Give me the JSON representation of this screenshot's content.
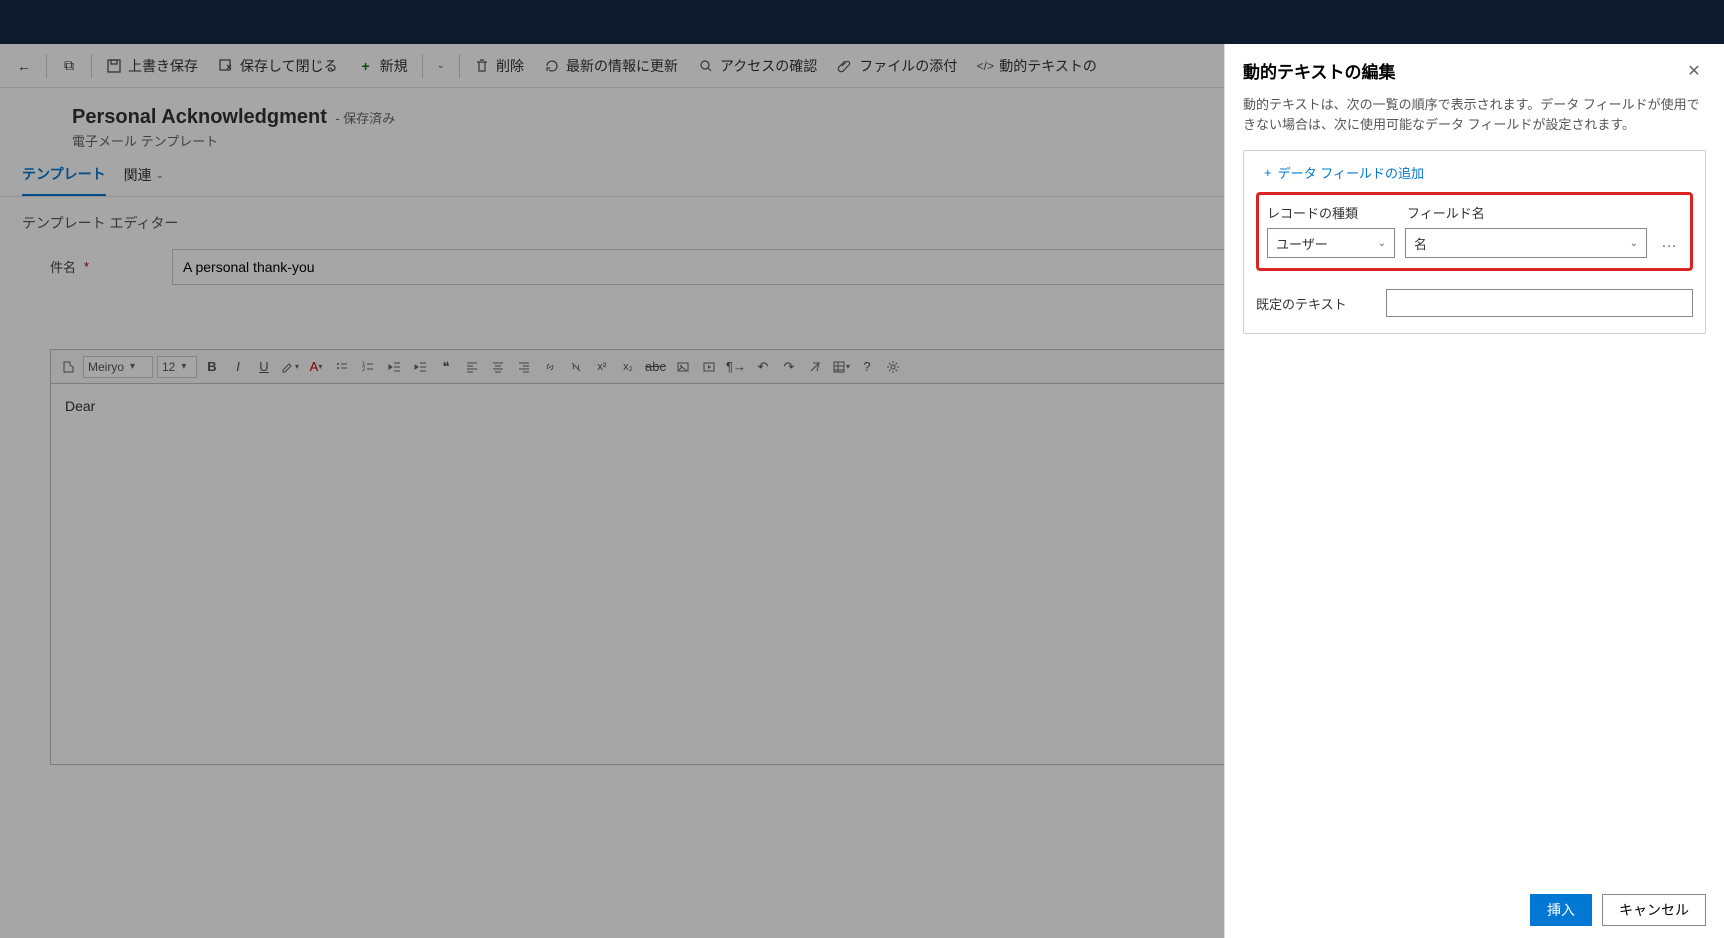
{
  "commands": {
    "save": "上書き保存",
    "save_close": "保存して閉じる",
    "new": "新規",
    "delete": "削除",
    "refresh": "最新の情報に更新",
    "check_access": "アクセスの確認",
    "attach": "ファイルの添付",
    "dynamic_text": "動的テキストの"
  },
  "header": {
    "title": "Personal Acknowledgment",
    "saved_suffix": "- 保存済み",
    "subtitle": "電子メール テンプレート"
  },
  "tabs": {
    "template": "テンプレート",
    "related": "関連"
  },
  "section": {
    "editor_label": "テンプレート エディター",
    "subject_label": "件名",
    "subject_value": "A personal thank-you"
  },
  "editor": {
    "font": "Meiryo",
    "size": "12",
    "body": "Dear"
  },
  "panel": {
    "title": "動的テキストの編集",
    "description": "動的テキストは、次の一覧の順序で表示されます。データ フィールドが使用できない場合は、次に使用可能なデータ フィールドが設定されます。",
    "add_field": "データ フィールドの追加",
    "record_type_label": "レコードの種類",
    "field_name_label": "フィールド名",
    "record_type_value": "ユーザー",
    "field_name_value": "名",
    "default_label": "既定のテキスト",
    "default_value": "",
    "insert": "挿入",
    "cancel": "キャンセル"
  }
}
